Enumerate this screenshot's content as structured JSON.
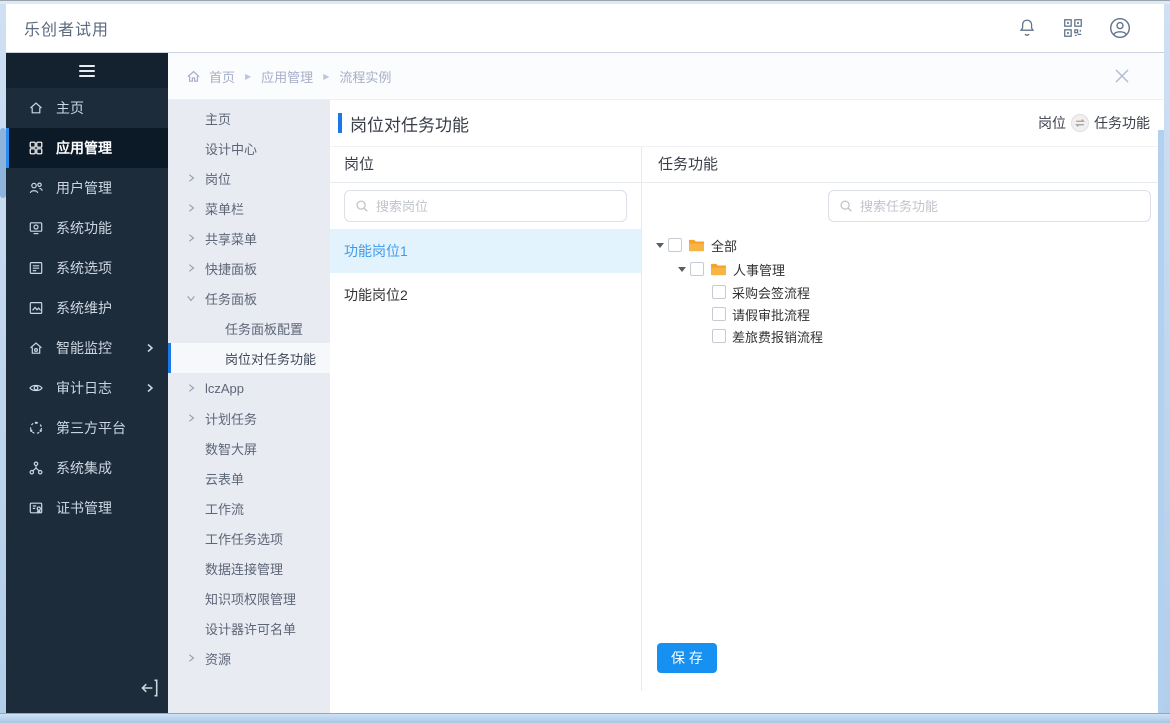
{
  "topbar": {
    "title": "乐创者试用",
    "icons": [
      "bell-icon",
      "qr-code-icon",
      "user-avatar-icon"
    ]
  },
  "sidebar": {
    "items": [
      {
        "label": "主页",
        "icon": "home-icon"
      },
      {
        "label": "应用管理",
        "icon": "app-grid-icon",
        "active": true
      },
      {
        "label": "用户管理",
        "icon": "users-icon"
      },
      {
        "label": "系统功能",
        "icon": "system-function-icon"
      },
      {
        "label": "系统选项",
        "icon": "system-options-icon"
      },
      {
        "label": "系统维护",
        "icon": "system-maintain-icon"
      },
      {
        "label": "智能监控",
        "icon": "smart-monitor-icon",
        "has_submenu": true
      },
      {
        "label": "审计日志",
        "icon": "audit-log-icon",
        "has_submenu": true
      },
      {
        "label": "第三方平台",
        "icon": "third-party-icon"
      },
      {
        "label": "系统集成",
        "icon": "integration-icon"
      },
      {
        "label": "证书管理",
        "icon": "certificate-icon"
      }
    ]
  },
  "secondary": {
    "items": [
      {
        "label": "主页"
      },
      {
        "label": "设计中心"
      },
      {
        "label": "岗位",
        "expand": "right"
      },
      {
        "label": "菜单栏",
        "expand": "right"
      },
      {
        "label": "共享菜单",
        "expand": "right"
      },
      {
        "label": "快捷面板",
        "expand": "right"
      },
      {
        "label": "任务面板",
        "expand": "down"
      },
      {
        "label": "任务面板配置",
        "sub": true
      },
      {
        "label": "岗位对任务功能",
        "sub": true,
        "active": true
      },
      {
        "label": "lczApp",
        "expand": "right"
      },
      {
        "label": "计划任务",
        "expand": "right"
      },
      {
        "label": "数智大屏"
      },
      {
        "label": "云表单"
      },
      {
        "label": "工作流"
      },
      {
        "label": "工作任务选项"
      },
      {
        "label": "数据连接管理"
      },
      {
        "label": "知识项权限管理"
      },
      {
        "label": "设计器许可名单"
      },
      {
        "label": "资源",
        "expand": "right"
      }
    ]
  },
  "breadcrumb": {
    "items": [
      "首页",
      "应用管理",
      "流程实例"
    ]
  },
  "content": {
    "title": "岗位对任务功能",
    "swap": {
      "left": "岗位",
      "right": "任务功能"
    },
    "left_panel": {
      "header": "岗位",
      "search_placeholder": "搜索岗位",
      "items": [
        {
          "label": "功能岗位1",
          "selected": true
        },
        {
          "label": "功能岗位2",
          "selected": false
        }
      ]
    },
    "right_panel": {
      "header": "任务功能",
      "search_placeholder": "搜索任务功能",
      "tree": [
        {
          "label": "全部",
          "level": 0,
          "caret": true,
          "folder": true,
          "checked": false
        },
        {
          "label": "人事管理",
          "level": 1,
          "caret": true,
          "folder": true,
          "checked": false
        },
        {
          "label": "采购会签流程",
          "level": 2,
          "caret": false,
          "folder": false,
          "checked": false
        },
        {
          "label": "请假审批流程",
          "level": 2,
          "caret": false,
          "folder": false,
          "checked": false
        },
        {
          "label": "差旅费报销流程",
          "level": 2,
          "caret": false,
          "folder": false,
          "checked": false
        }
      ],
      "save_label": "保 存"
    }
  },
  "colors": {
    "accent_blue": "#1a78e8",
    "save_button": "#1691f2",
    "sidebar_bg": "#1d2c3b",
    "sidebar_active_bg": "#0c1a28",
    "secondary_bg": "#e9ebf3",
    "selected_item_bg": "#e2f3fd",
    "selected_item_text": "#3f9bea",
    "folder_orange": "#f5a32b",
    "frame_blue": "#b9d2eb"
  }
}
